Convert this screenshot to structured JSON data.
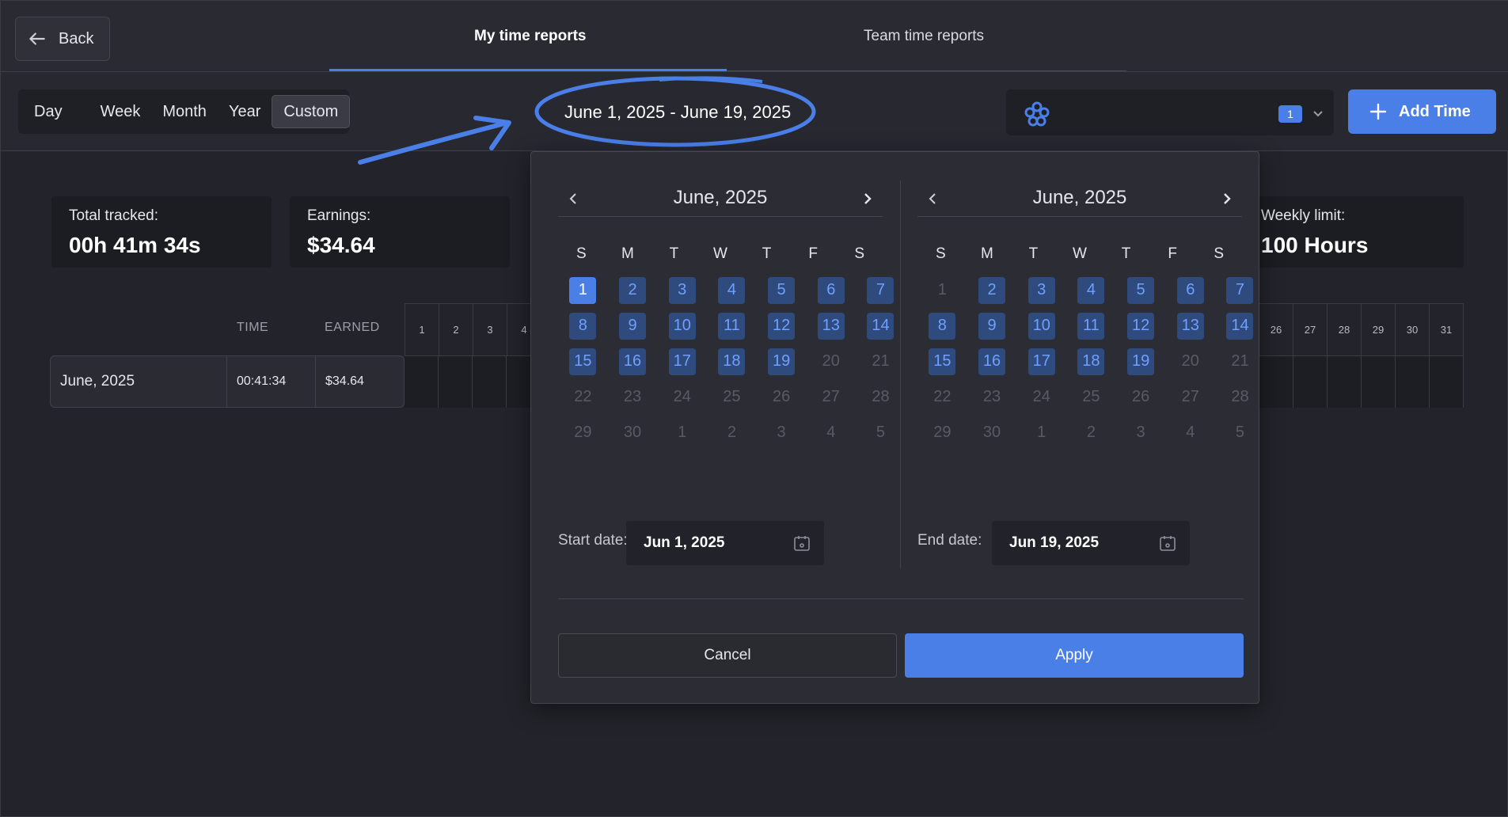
{
  "header": {
    "back_label": "Back",
    "tabs": [
      {
        "label": "My time reports",
        "active": true
      },
      {
        "label": "Team time reports",
        "active": false
      }
    ]
  },
  "toolbar": {
    "ranges": [
      "Day",
      "Week",
      "Month",
      "Year",
      "Custom"
    ],
    "active_range": "Custom",
    "date_range": "June 1, 2025 - June 19, 2025",
    "project_badge": "1",
    "add_label": "Add Time",
    "accent": "#4a7fe8"
  },
  "stats": {
    "total_label": "Total tracked:",
    "total_value": "00h 41m 34s",
    "earnings_label": "Earnings:",
    "earnings_value": "$34.64",
    "limit_label": "Weekly limit:",
    "limit_value": "100 Hours"
  },
  "table": {
    "headers": {
      "time": "TIME",
      "earned": "EARNED"
    },
    "row": {
      "period": "June, 2025",
      "time": "00:41:34",
      "earned": "$34.64"
    },
    "days_left": [
      "1",
      "2",
      "3",
      "4"
    ],
    "days_right": [
      "26",
      "27",
      "28",
      "29",
      "30",
      "31"
    ]
  },
  "picker": {
    "left": {
      "title": "June, 2025"
    },
    "right": {
      "title": "June, 2025"
    },
    "weekdays": [
      "S",
      "M",
      "T",
      "W",
      "T",
      "F",
      "S"
    ],
    "days": [
      "1",
      "2",
      "3",
      "4",
      "5",
      "6",
      "7",
      "8",
      "9",
      "10",
      "11",
      "12",
      "13",
      "14",
      "15",
      "16",
      "17",
      "18",
      "19",
      "20",
      "21",
      "22",
      "23",
      "24",
      "25",
      "26",
      "27",
      "28",
      "29",
      "30",
      "1",
      "2",
      "3",
      "4",
      "5"
    ],
    "start_label": "Start date:",
    "start_value": "Jun 1, 2025",
    "end_label": "End date:",
    "end_value": "Jun 19, 2025",
    "cancel_label": "Cancel",
    "apply_label": "Apply"
  }
}
